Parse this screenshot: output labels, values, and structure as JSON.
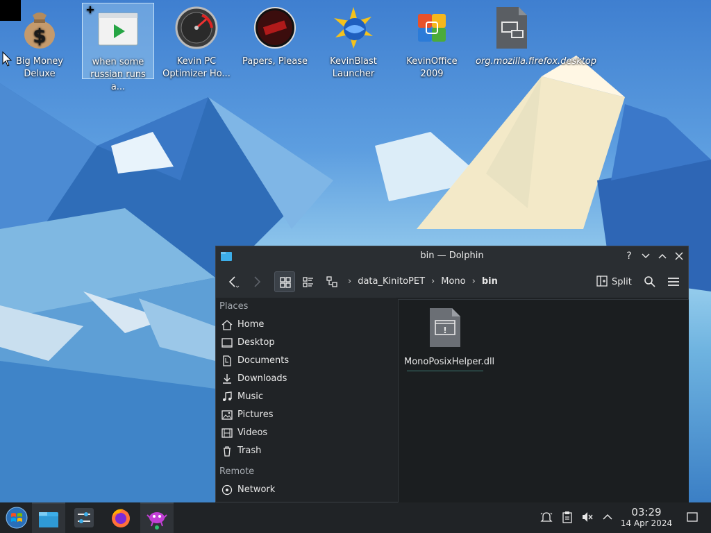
{
  "desktop": {
    "icons": [
      {
        "label": "Big Money Deluxe",
        "icon": "money-bag-icon"
      },
      {
        "label": "when some russian runs a...",
        "icon": "video-player-icon"
      },
      {
        "label": "Kevin PC Optimizer Ho...",
        "icon": "speedometer-icon"
      },
      {
        "label": "Papers, Please",
        "icon": "papers-please-icon"
      },
      {
        "label": "KevinBlast Launcher",
        "icon": "globe-star-icon"
      },
      {
        "label": "KevinOffice 2009",
        "icon": "office-logo-icon"
      },
      {
        "label": "org.mozilla.firefox.desktop",
        "icon": "desktop-file-icon"
      }
    ]
  },
  "window": {
    "title": "bin — Dolphin",
    "breadcrumb": [
      "data_KinitoPET",
      "Mono",
      "bin"
    ],
    "split_label": "Split",
    "places_header": "Places",
    "places": [
      "Home",
      "Desktop",
      "Documents",
      "Downloads",
      "Music",
      "Pictures",
      "Videos",
      "Trash"
    ],
    "remote_header": "Remote",
    "remote": [
      "Network"
    ],
    "files": [
      {
        "name": "MonoPosixHelper.dll",
        "icon": "dll-file-icon"
      }
    ]
  },
  "taskbar": {
    "tasks": [
      "application-launcher",
      "dolphin",
      "system-settings",
      "firefox",
      "kinito-pet"
    ],
    "time": "03:29",
    "date": "14 Apr 2024"
  },
  "colors": {
    "accent": "#3daee9",
    "window_bg": "#202326",
    "taskbar_bg": "#202326"
  }
}
